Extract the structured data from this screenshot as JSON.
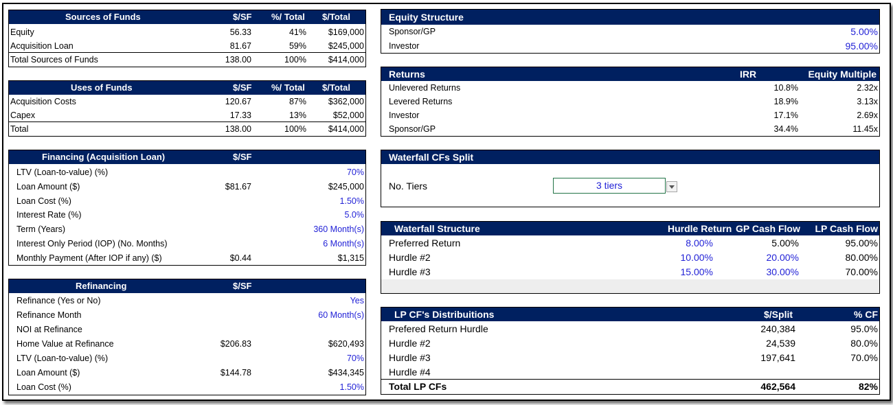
{
  "sources": {
    "title": "Sources of Funds",
    "col1": "$/SF",
    "col2": "%/ Total",
    "col3": "$/Total",
    "rows": [
      {
        "label": "Equity",
        "sf": "56.33",
        "pct": "41%",
        "total": "$169,000"
      },
      {
        "label": "Acquisition Loan",
        "sf": "81.67",
        "pct": "59%",
        "total": "$245,000"
      },
      {
        "label": "Total Sources of Funds",
        "sf": "138.00",
        "pct": "100%",
        "total": "$414,000"
      }
    ]
  },
  "uses": {
    "title": "Uses of Funds",
    "col1": "$/SF",
    "col2": "%/ Total",
    "col3": "$/Total",
    "rows": [
      {
        "label": "Acquisition Costs",
        "sf": "120.67",
        "pct": "87%",
        "total": "$362,000"
      },
      {
        "label": "Capex",
        "sf": "17.33",
        "pct": "13%",
        "total": "$52,000"
      },
      {
        "label": "Total",
        "sf": "138.00",
        "pct": "100%",
        "total": "$414,000"
      }
    ]
  },
  "financing": {
    "title": "Financing (Acquisition Loan)",
    "col1": "$/SF",
    "rows": [
      {
        "label": "LTV (Loan-to-value) (%)",
        "sf": "",
        "value": "70%"
      },
      {
        "label": "Loan Amount ($)",
        "sf": "$81.67",
        "value": "$245,000"
      },
      {
        "label": "Loan Cost (%)",
        "sf": "",
        "value": "1.50%"
      },
      {
        "label": "Interest Rate (%)",
        "sf": "",
        "value": "5.0%"
      },
      {
        "label": "Term (Years)",
        "sf": "",
        "value": "360 Month(s)"
      },
      {
        "label": "Interest Only Period (IOP) (No. Months)",
        "sf": "",
        "value": "6 Month(s)"
      },
      {
        "label": "Monthly Payment (After IOP if any) ($)",
        "sf": "$0.44",
        "value": "$1,315"
      }
    ]
  },
  "refinancing": {
    "title": "Refinancing",
    "col1": "$/SF",
    "rows": [
      {
        "label": "Refinance (Yes or No)",
        "sf": "",
        "value": "Yes"
      },
      {
        "label": "Refinance Month",
        "sf": "",
        "value": "60 Month(s)"
      },
      {
        "label": "NOI at Refinance",
        "sf": "",
        "value": ""
      },
      {
        "label": "Home Value at Refinance",
        "sf": "$206.83",
        "value": "$620,493"
      },
      {
        "label": "LTV (Loan-to-value) (%)",
        "sf": "",
        "value": "70%"
      },
      {
        "label": "Loan Amount ($)",
        "sf": "$144.78",
        "value": "$434,345"
      },
      {
        "label": "Loan Cost (%)",
        "sf": "",
        "value": "1.50%"
      }
    ]
  },
  "equity": {
    "title": "Equity Structure",
    "rows": [
      {
        "label": "Sponsor/GP",
        "value": "5.00%"
      },
      {
        "label": "Investor",
        "value": "95.00%"
      }
    ]
  },
  "returns": {
    "title": "Returns",
    "col1": "IRR",
    "col2": "Equity Multiple",
    "rows": [
      {
        "label": "Unlevered Returns",
        "irr": "10.8%",
        "em": "2.32x"
      },
      {
        "label": "Levered Returns",
        "irr": "18.9%",
        "em": "3.13x"
      },
      {
        "label": "Investor",
        "irr": "17.1%",
        "em": "2.69x"
      },
      {
        "label": "Sponsor/GP",
        "irr": "34.4%",
        "em": "11.45x"
      }
    ]
  },
  "waterfall_split": {
    "title": "Waterfall CFs Split",
    "tiers_label": "No. Tiers",
    "tiers_value": "3 tiers"
  },
  "waterfall_structure": {
    "title": "Waterfall Structure",
    "col1": "Hurdle Return",
    "col2": "GP Cash Flow",
    "col3": "LP Cash Flow",
    "rows": [
      {
        "label": "Preferred Return",
        "hurdle": "8.00%",
        "gp": "5.00%",
        "lp": "95.00%"
      },
      {
        "label": "Hurdle #2",
        "hurdle": "10.00%",
        "gp": "20.00%",
        "lp": "80.00%"
      },
      {
        "label": "Hurdle #3",
        "hurdle": "15.00%",
        "gp": "30.00%",
        "lp": "70.00%"
      }
    ]
  },
  "lp_distributions": {
    "title": "LP CF's Distribuitions",
    "col1": "$/Split",
    "col2": "% CF",
    "rows": [
      {
        "label": "Prefered  Return Hurdle",
        "split": "240,384",
        "pct": "95.0%"
      },
      {
        "label": "Hurdle #2",
        "split": "24,539",
        "pct": "80.0%"
      },
      {
        "label": "Hurdle #3",
        "split": "197,641",
        "pct": "70.0%"
      },
      {
        "label": "Hurdle #4",
        "split": "",
        "pct": ""
      }
    ],
    "total": {
      "label": "Total LP CFs",
      "split": "462,564",
      "pct": "82%"
    }
  }
}
